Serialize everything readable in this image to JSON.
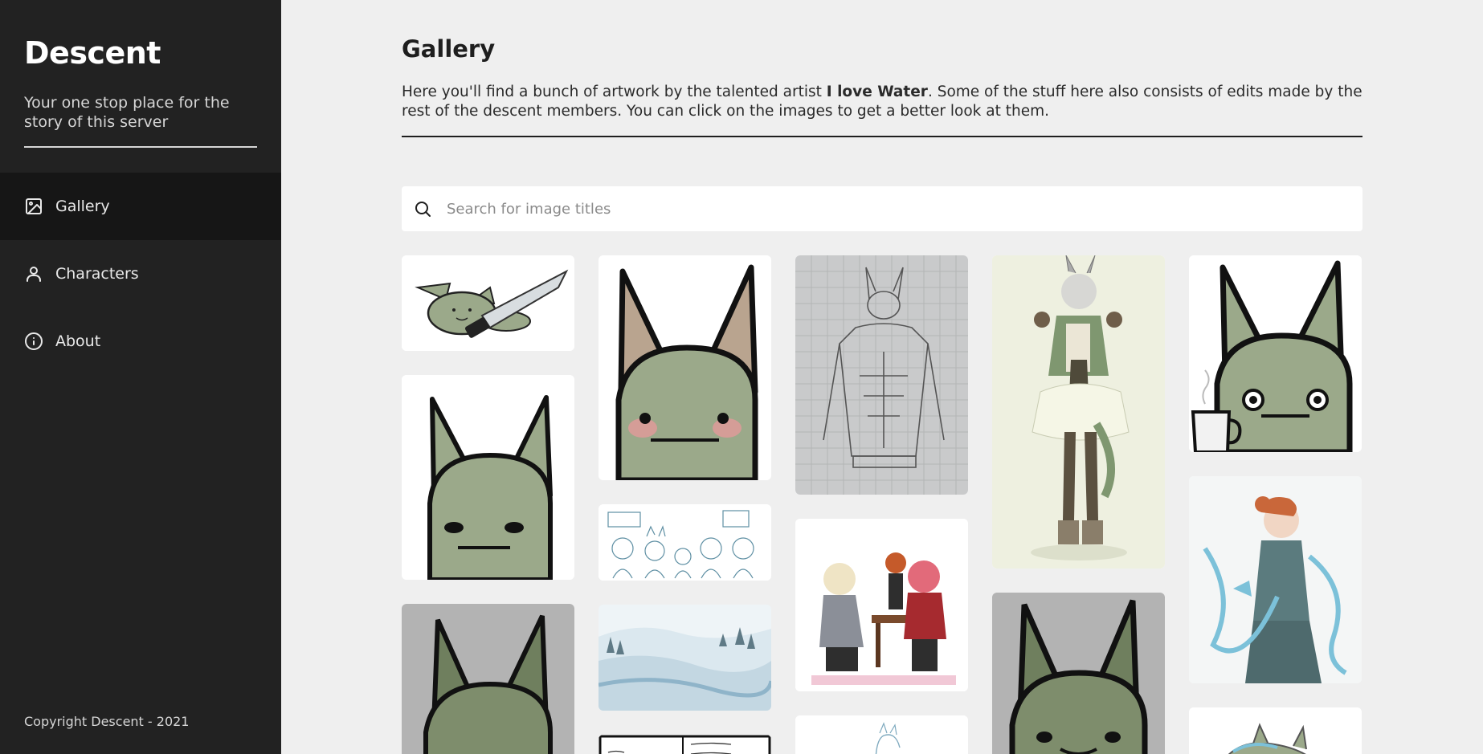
{
  "sidebar": {
    "brand": "Descent",
    "tagline": "Your one stop place for the story of this server",
    "nav": [
      {
        "label": "Gallery",
        "icon": "image-icon",
        "active": true
      },
      {
        "label": "Characters",
        "icon": "user-icon",
        "active": false
      },
      {
        "label": "About",
        "icon": "info-icon",
        "active": false
      }
    ],
    "copyright": "Copyright Descent - 2021"
  },
  "main": {
    "title": "Gallery",
    "intro_before": "Here you'll find a bunch of artwork by the talented artist ",
    "artist": "I love Water",
    "intro_after": ". Some of the stuff here also consists of edits made by the rest of the descent members. You can click on the images to get a better look at them.",
    "search": {
      "placeholder": "Search for image titles",
      "value": ""
    }
  },
  "gallery": {
    "images": [
      "creature-with-knife-image",
      "creature-face-image",
      "creature-blush-image",
      "sketch-group-image",
      "snow-landscape-image",
      "comic-panel-image",
      "pencil-sketch-image",
      "school-girls-image",
      "partial-image",
      "armored-girl-image",
      "creature-gray-image",
      "creature-coffee-image",
      "ribbon-character-image",
      "partial-image-2"
    ]
  },
  "colors": {
    "sidebar_bg": "#222222",
    "sidebar_active": "#161616",
    "page_bg": "#efefef",
    "creature_green": "#9ba98a"
  }
}
